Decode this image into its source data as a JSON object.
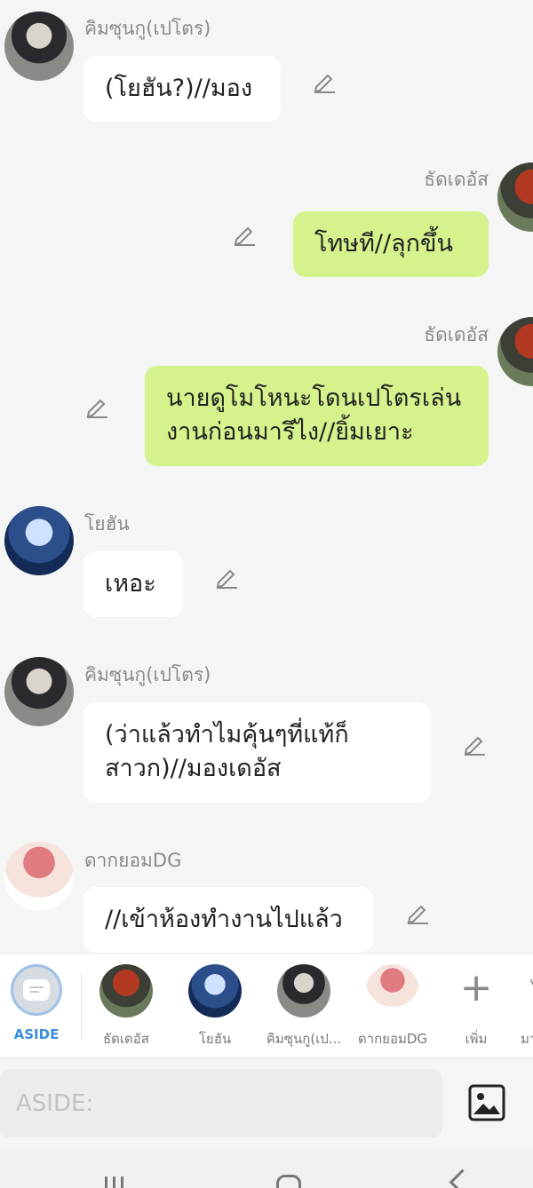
{
  "messages": [
    {
      "speaker": "คิมซุนกู(เปโตร)",
      "text": "(โยฮัน?)//มอง"
    },
    {
      "speaker": "ธัดเดอัส",
      "text": "โทษที//ลุกขึ้น"
    },
    {
      "speaker": "ธัดเดอัส",
      "text": "นายดูโมโหนะโดนเปโตรเล่น\nงานก่อนมารึไง//ยิ้มเยาะ"
    },
    {
      "speaker": "โยฮัน",
      "text": "เหอะ"
    },
    {
      "speaker": "คิมซุนกู(เปโตร)",
      "text": "(ว่าแล้วทำไมคุ้นๆที่แท้ก็\nสาวก)//มองเดอัส"
    },
    {
      "speaker": "ดากยอมDG",
      "text": "//เข้าห้องทำงานไปแล้ว"
    }
  ],
  "character_bar": {
    "aside_label": "ASIDE",
    "characters": [
      "ธัดเดอัส",
      "โยฮัน",
      "คิมซุนกู(เป...",
      "ดากยอมDG"
    ],
    "add_label": "เพิ่ม",
    "more_label": "มา"
  },
  "input": {
    "placeholder": "ASIDE:"
  },
  "colors": {
    "bubble_green": "#d6f28c",
    "bubble_white": "#ffffff",
    "accent_blue": "#3b8edd"
  },
  "icons": [
    "edit-pencil-icon",
    "image-icon",
    "plus-icon",
    "recent-apps-icon",
    "home-icon",
    "back-icon"
  ]
}
